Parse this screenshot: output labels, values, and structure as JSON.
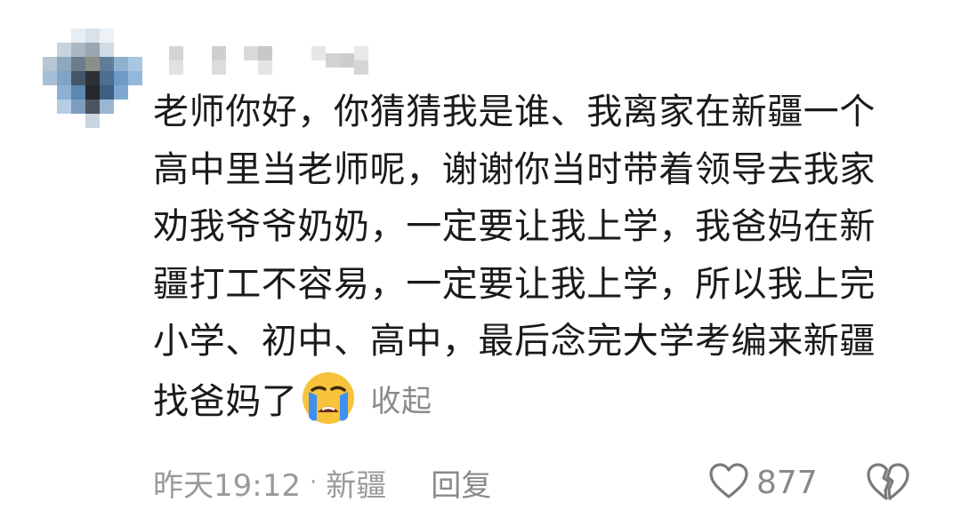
{
  "comment": {
    "avatar_icon": "pixelated-avatar",
    "username_icon": "pixelated-username",
    "content_lines": [
      "老师你好，你猜猜我是谁、我离家在新疆一个",
      "高中里当老师呢，谢谢你当时带着领导去我家",
      "劝我爷爷奶奶，一定要让我上学，我爸妈在新",
      "疆打工不容易，一定要让我上学，所以我上完",
      "小学、初中、高中，最后念完大学考编来新疆",
      "找爸妈了"
    ],
    "emoji": "crying-face-emoji",
    "collapse_label": "收起",
    "time": "昨天19:12",
    "separator": "·",
    "location": "新疆",
    "reply_label": "回复",
    "like_icon": "heart-outline-icon",
    "like_count": "877",
    "dislike_icon": "broken-heart-icon",
    "colors": {
      "text": "#1a1a1a",
      "secondary": "#8a8a8a",
      "emoji_face": "#f7c33a",
      "emoji_tears": "#3e8ff2"
    }
  }
}
